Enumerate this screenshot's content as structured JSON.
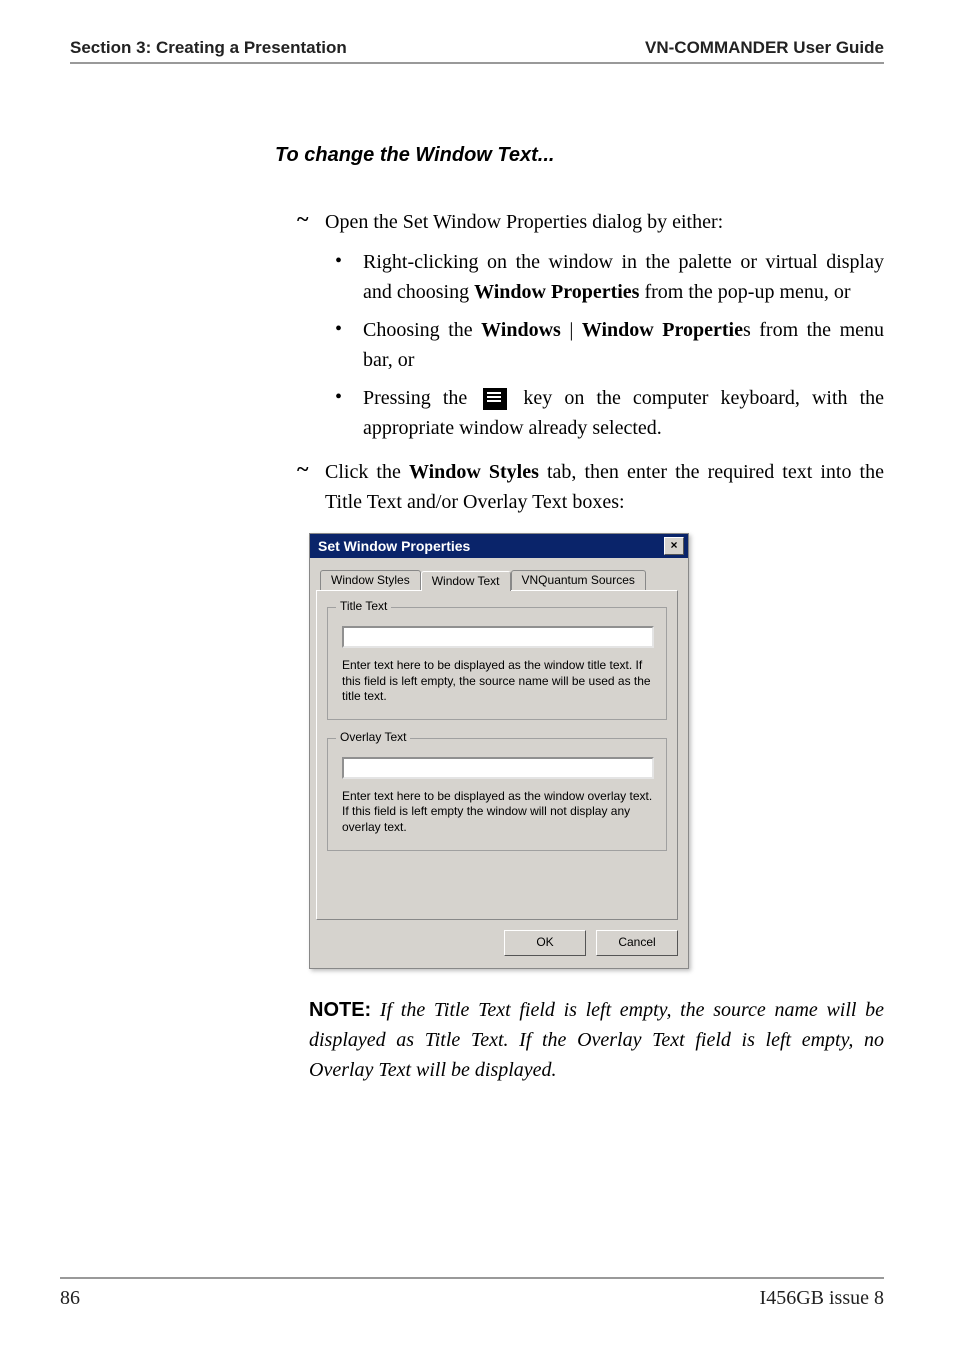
{
  "header": {
    "left": "Section 3: Creating a Presentation",
    "right": "VN-COMMANDER User Guide"
  },
  "subheading": "To change the Window Text...",
  "step1_intro": "Open the Set Window Properties dialog by either:",
  "bullets": {
    "b1_a": "Right-clicking on the window in the palette or virtual display and choosing ",
    "b1_b": "Window Properties",
    "b1_c": " from the pop-up menu, or",
    "b2_a": "Choosing the ",
    "b2_b": "Windows",
    "b2_c": " | ",
    "b2_d": "Window Propertie",
    "b2_e": "s from the menu bar, or",
    "b3_a": "Pressing the ",
    "b3_b": " key on the computer keyboard, with the appropriate window already selected."
  },
  "step2_a": "Click the ",
  "step2_b": "Window Styles",
  "step2_c": " tab, then enter the required text into the Title Text and/or Overlay Text boxes:",
  "dialog": {
    "title": "Set Window Properties",
    "tabs": {
      "t1": "Window Styles",
      "t2": "Window Text",
      "t3": "VNQuantum Sources"
    },
    "group1": {
      "label": "Title Text",
      "help": "Enter text here to be displayed as the window title text. If this field is left empty, the source name will be used as the title text."
    },
    "group2": {
      "label": "Overlay Text",
      "help": "Enter text here to be displayed as the window overlay text. If this field is left empty the window will not display any overlay text."
    },
    "ok": "OK",
    "cancel": "Cancel",
    "close_x": "×"
  },
  "note": {
    "label": "NOTE:",
    "body": " If the Title Text field is left empty, the source name will be displayed as Title Text. If the Overlay Text field is left empty, no Overlay Text will be displayed."
  },
  "footer": {
    "page": "86",
    "issue": "I456GB issue 8"
  }
}
